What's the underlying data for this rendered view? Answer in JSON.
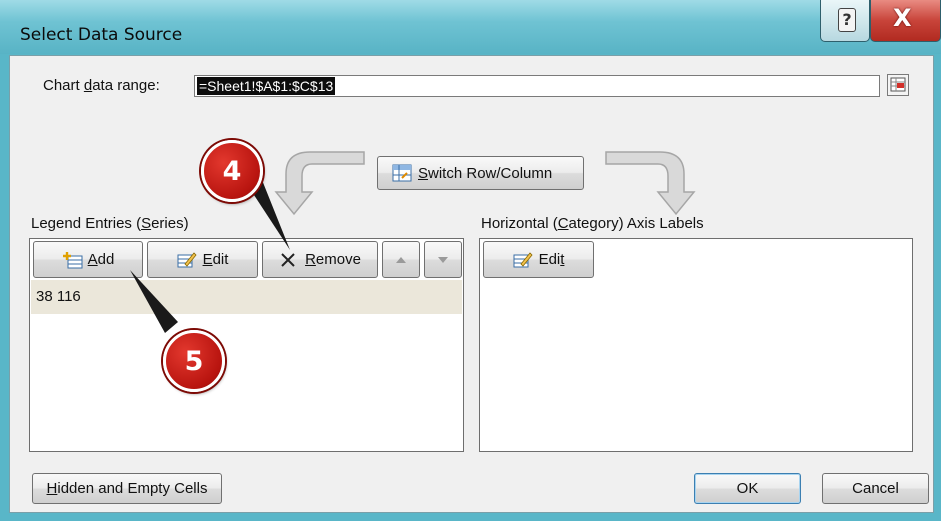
{
  "window": {
    "title": "Select Data Source",
    "help_glyph": "?",
    "close_glyph": "X"
  },
  "range": {
    "label_pre": "Chart ",
    "label_key": "d",
    "label_post": "ata range:",
    "value": "=Sheet1!$A$1:$C$13",
    "collapse_icon": "range-collapse-icon"
  },
  "switch_button": {
    "label_pre": "",
    "label_key": "S",
    "label_post": "witch Row/Column",
    "icon": "switch-grid-icon"
  },
  "legend": {
    "heading_pre": "Legend Entries (",
    "heading_key": "S",
    "heading_post": "eries)",
    "add_label_key": "A",
    "add_label_rest": "dd",
    "edit_label_key": "E",
    "edit_label_rest": "dit",
    "remove_label_key": "R",
    "remove_label_rest": "emove",
    "series": [
      "38 116"
    ]
  },
  "axis": {
    "heading_pre": "Horizontal (",
    "heading_key": "C",
    "heading_post": "ategory) Axis Labels",
    "edit_label_pre": "Edi",
    "edit_label_key": "t"
  },
  "footer": {
    "hidden_label_key": "H",
    "hidden_label_rest": "idden and Empty Cells",
    "ok_label": "OK",
    "cancel_label": "Cancel"
  },
  "callouts": [
    "4",
    "5"
  ],
  "colors": {
    "window_frame": "#59b6c8",
    "client_bg": "#f0f0f0",
    "selected_row": "#ebe7da",
    "callout_red": "#c41a12",
    "close_red": "#c8443a"
  }
}
